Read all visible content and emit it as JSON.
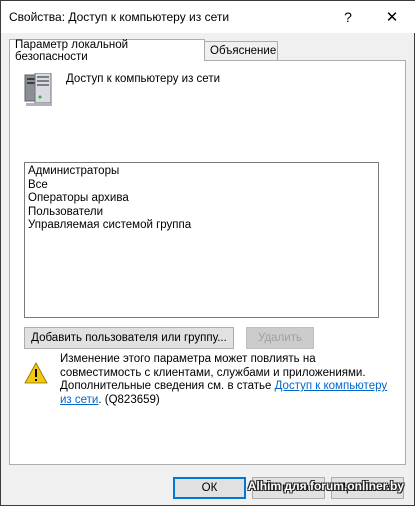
{
  "window": {
    "title": "Свойства: Доступ к компьютеру из сети",
    "help_label": "?",
    "close_label": "✕"
  },
  "tabs": [
    {
      "label": "Параметр локальной безопасности"
    },
    {
      "label": "Объяснение"
    }
  ],
  "policy": {
    "name": "Доступ к компьютеру из сети",
    "icon": "server-icon"
  },
  "members": [
    "Администраторы",
    "Все",
    "Операторы архива",
    "Пользователи",
    "Управляемая системой группа"
  ],
  "buttons": {
    "add_label": "Добавить пользователя или группу...",
    "remove_label": "Удалить",
    "ok_label": "ОК",
    "cancel_label": "Отмена",
    "apply_label": "Применить"
  },
  "warning": {
    "icon": "warning-icon",
    "text": "Изменение этого параметра может повлиять на совместимость с клиентами, службами и приложениями. Дополнительные сведения см. в статье ",
    "link": "Доступ к компьютеру из сети",
    "suffix": ". (Q823659)"
  },
  "watermark": "Alhim для forum.onliner.by",
  "colors": {
    "accent": "#0078d7",
    "link": "#0066cc",
    "warning": "#f2c811"
  }
}
